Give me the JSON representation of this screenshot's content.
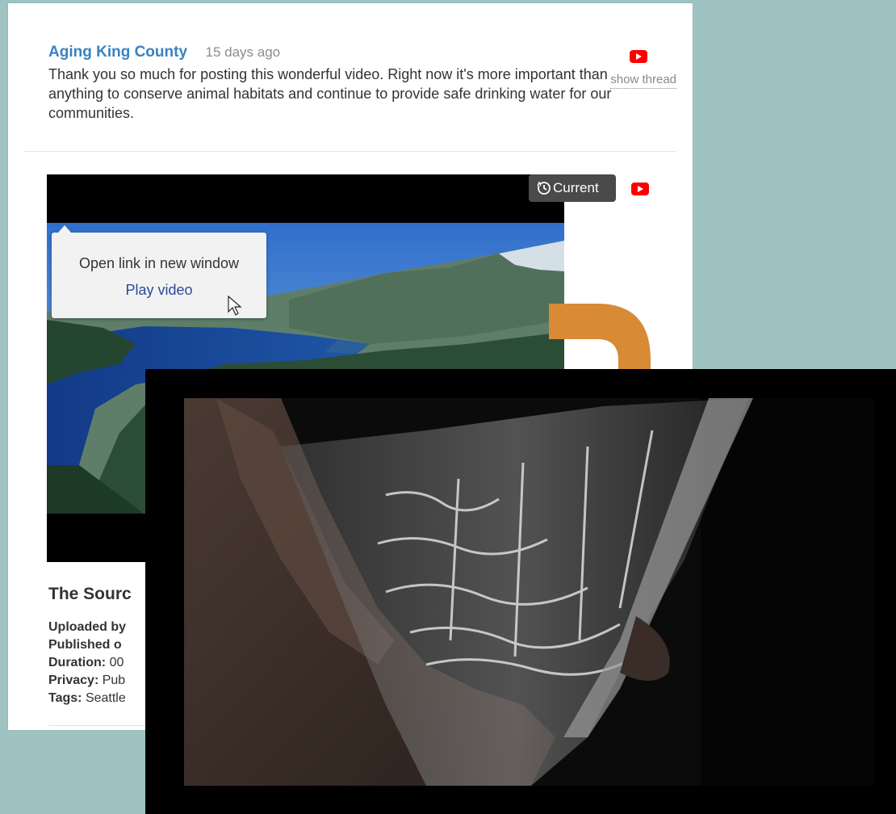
{
  "comment": {
    "author": "Aging King County",
    "time": "15 days ago",
    "text": "Thank you so much for posting this wonderful video. Right now it's more important than anything to conserve animal habitats and continue to provide safe drinking water for our communities.",
    "show_thread": "show thread",
    "source_icon": "youtube-icon"
  },
  "video": {
    "current_label": "Current",
    "source_icon": "youtube-icon",
    "tooltip": {
      "open_link": "Open link in new window",
      "play": "Play video"
    },
    "title": "The Sourc",
    "meta": [
      {
        "label": "Uploaded by",
        "value": ""
      },
      {
        "label": "Published o",
        "value": ""
      },
      {
        "label": "Duration:",
        "value": "00"
      },
      {
        "label": "Privacy:",
        "value": "Pub"
      },
      {
        "label": "Tags:",
        "value": "Seattle"
      }
    ]
  },
  "colors": {
    "background": "#9fc3c2",
    "author_link": "#3a81c2",
    "arrow": "#d98a35",
    "youtube_red": "#ff0000"
  }
}
